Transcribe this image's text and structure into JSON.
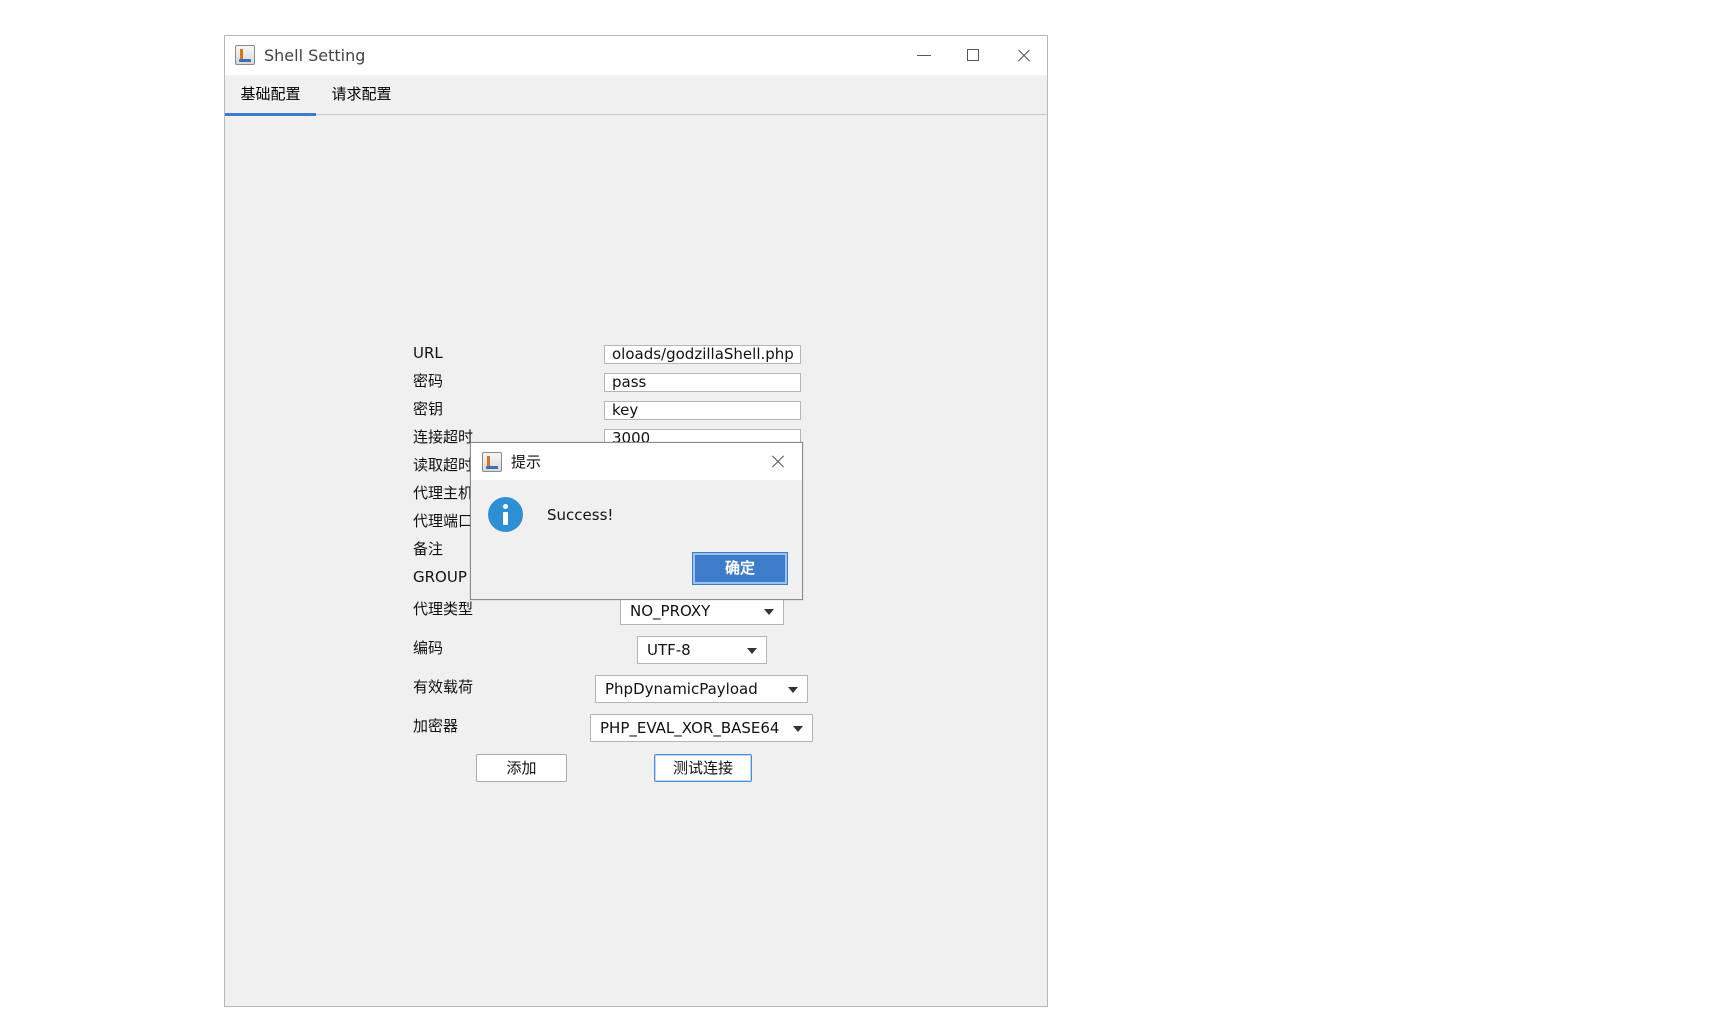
{
  "window": {
    "title": "Shell Setting"
  },
  "tabs": [
    {
      "label": "基础配置",
      "active": true
    },
    {
      "label": "请求配置",
      "active": false
    }
  ],
  "form": {
    "url_label": "URL",
    "url_value": "oloads/godzillaShell.php",
    "password_label": "密码",
    "password_value": "pass",
    "key_label": "密钥",
    "key_value": "key",
    "connect_timeout_label": "连接超时",
    "connect_timeout_value": "3000",
    "read_timeout_label": "读取超时",
    "proxy_host_label": "代理主机",
    "proxy_port_label": "代理端口",
    "remark_label": "备注",
    "group_label": "GROUP",
    "proxy_type_label": "代理类型",
    "proxy_type_value": "NO_PROXY",
    "encoding_label": "编码",
    "encoding_value": "UTF-8",
    "payload_label": "有效载荷",
    "payload_value": "PhpDynamicPayload",
    "cryption_label": "加密器",
    "cryption_value": "PHP_EVAL_XOR_BASE64",
    "add_button": "添加",
    "test_button": "测试连接"
  },
  "dialog": {
    "title": "提示",
    "message": "Success!",
    "ok_button": "确定"
  },
  "colors": {
    "accent": "#3d7bd1",
    "info_icon": "#2f8fd4",
    "ok_button": "#3c7cc8"
  },
  "icons": {
    "app": "java-cup-icon",
    "info": "info-icon"
  }
}
